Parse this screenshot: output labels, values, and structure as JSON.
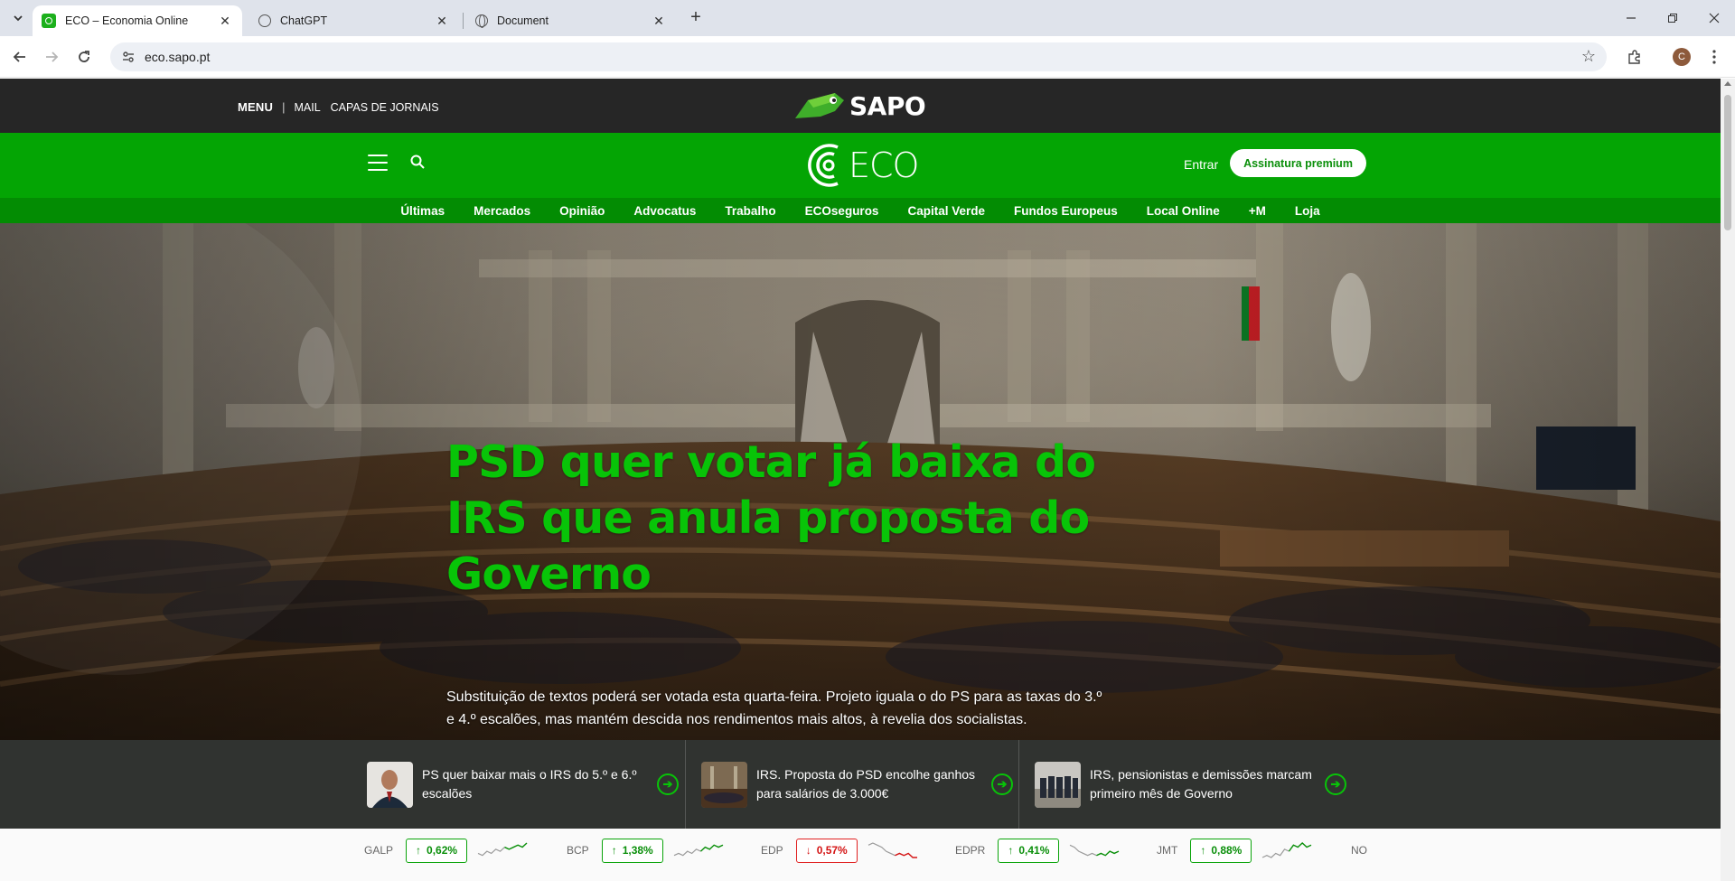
{
  "browser": {
    "tabs": [
      {
        "title": "ECO – Economia Online",
        "active": true,
        "icon": "eco-favicon"
      },
      {
        "title": "ChatGPT",
        "active": false,
        "icon": "chatgpt-icon"
      },
      {
        "title": "Document",
        "active": false,
        "icon": "globe-icon"
      }
    ],
    "url": "eco.sapo.pt",
    "profile_initial": "C"
  },
  "sapo": {
    "menu_label": "MENU",
    "links": [
      "MAIL",
      "CAPAS DE JORNAIS"
    ],
    "logo_text": "SAPO"
  },
  "eco": {
    "logo_text": "ECO",
    "login_label": "Entrar",
    "premium_label": "Assinatura premium",
    "nav": [
      "Últimas",
      "Mercados",
      "Opinião",
      "Advocatus",
      "Trabalho",
      "ECOseguros",
      "Capital Verde",
      "Fundos Europeus",
      "Local Online",
      "+M",
      "Loja"
    ]
  },
  "hero": {
    "title": "PSD quer votar já baixa do IRS que anula proposta do Governo",
    "subtitle": "Substituição de textos poderá ser votada esta quarta-feira. Projeto iguala o do PS para as taxas do 3.º e 4.º escalões, mas mantém descida nos rendimentos mais altos, à revelia dos socialistas."
  },
  "related": [
    {
      "text": "PS quer baixar mais o IRS do 5.º e 6.º escalões"
    },
    {
      "text": "IRS. Proposta do PSD encolhe ganhos para salários de 3.000€"
    },
    {
      "text": "IRS, pensionistas e demissões marcam primeiro mês de Governo"
    }
  ],
  "ticker": [
    {
      "symbol": "GALP",
      "change": "0,62%",
      "direction": "up",
      "trend": [
        5,
        6,
        4,
        5,
        3,
        4,
        2,
        3,
        2,
        1,
        2,
        0
      ]
    },
    {
      "symbol": "BCP",
      "change": "1,38%",
      "direction": "up",
      "trend": [
        6,
        5,
        6,
        4,
        5,
        3,
        4,
        2,
        3,
        1,
        2,
        1
      ]
    },
    {
      "symbol": "EDP",
      "change": "0,57%",
      "direction": "down",
      "trend": [
        1,
        0,
        1,
        2,
        4,
        5,
        6,
        5,
        6,
        5,
        7,
        7
      ]
    },
    {
      "symbol": "EDPR",
      "change": "0,41%",
      "direction": "up",
      "trend": [
        1,
        2,
        4,
        5,
        6,
        5,
        6,
        5,
        6,
        4,
        5,
        4
      ]
    },
    {
      "symbol": "JMT",
      "change": "0,88%",
      "direction": "up",
      "trend": [
        7,
        6,
        7,
        5,
        6,
        3,
        4,
        1,
        2,
        0,
        2,
        1
      ]
    },
    {
      "symbol": "NO"
    }
  ],
  "colors": {
    "eco_green": "#04a504",
    "eco_nav_green": "#038c03",
    "headline_green": "#08c408",
    "sapo_dark": "#262626",
    "up": "#0a8f0a",
    "down": "#d41414"
  }
}
